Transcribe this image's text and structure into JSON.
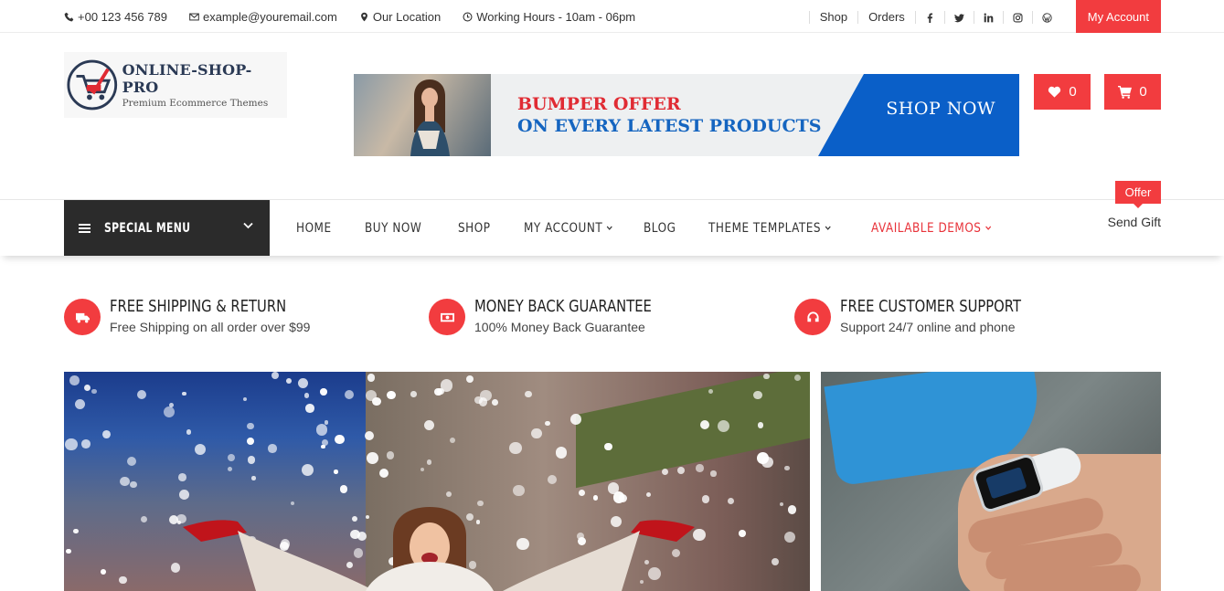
{
  "topbar": {
    "phone": "+00 123 456 789",
    "email": "example@youremail.com",
    "location": "Our Location",
    "hours": "Working Hours - 10am - 06pm",
    "links": [
      "Shop",
      "Orders"
    ],
    "social_icons": [
      "facebook-icon",
      "twitter-icon",
      "linkedin-icon",
      "instagram-icon",
      "wordpress-icon"
    ],
    "account_button": "My Account"
  },
  "brand": {
    "name": "ONLINE-SHOP-PRO",
    "tagline": "Premium Ecommerce Themes"
  },
  "banner": {
    "line1": "BUMPER OFFER",
    "line2": "ON EVERY LATEST PRODUCTS",
    "cta": "SHOP NOW"
  },
  "header_actions": {
    "wishlist_count": "0",
    "cart_count": "0"
  },
  "nav": {
    "special_menu": "SPECIAL MENU",
    "items": [
      {
        "label": "HOME"
      },
      {
        "label": "BUY NOW"
      },
      {
        "label": "SHOP"
      },
      {
        "label": "MY ACCOUNT",
        "dropdown": true
      },
      {
        "label": "BLOG"
      },
      {
        "label": "THEME TEMPLATES",
        "dropdown": true
      },
      {
        "label": "AVAILABLE DEMOS",
        "dropdown": true,
        "highlight": true
      }
    ],
    "offer_badge": "Offer",
    "send_gift": "Send Gift"
  },
  "features": [
    {
      "icon": "truck-icon",
      "title": "FREE SHIPPING & RETURN",
      "subtitle": "Free Shipping on all order over $99"
    },
    {
      "icon": "money-icon",
      "title": "MONEY BACK GUARANTEE",
      "subtitle": "100% Money Back Guarantee"
    },
    {
      "icon": "headphones-icon",
      "title": "FREE CUSTOMER SUPPORT",
      "subtitle": "Support 24/7 online and phone"
    }
  ],
  "colors": {
    "accent": "#f23c3f",
    "dark": "#2b2b2b",
    "banner_blue": "#0a5fc8"
  }
}
